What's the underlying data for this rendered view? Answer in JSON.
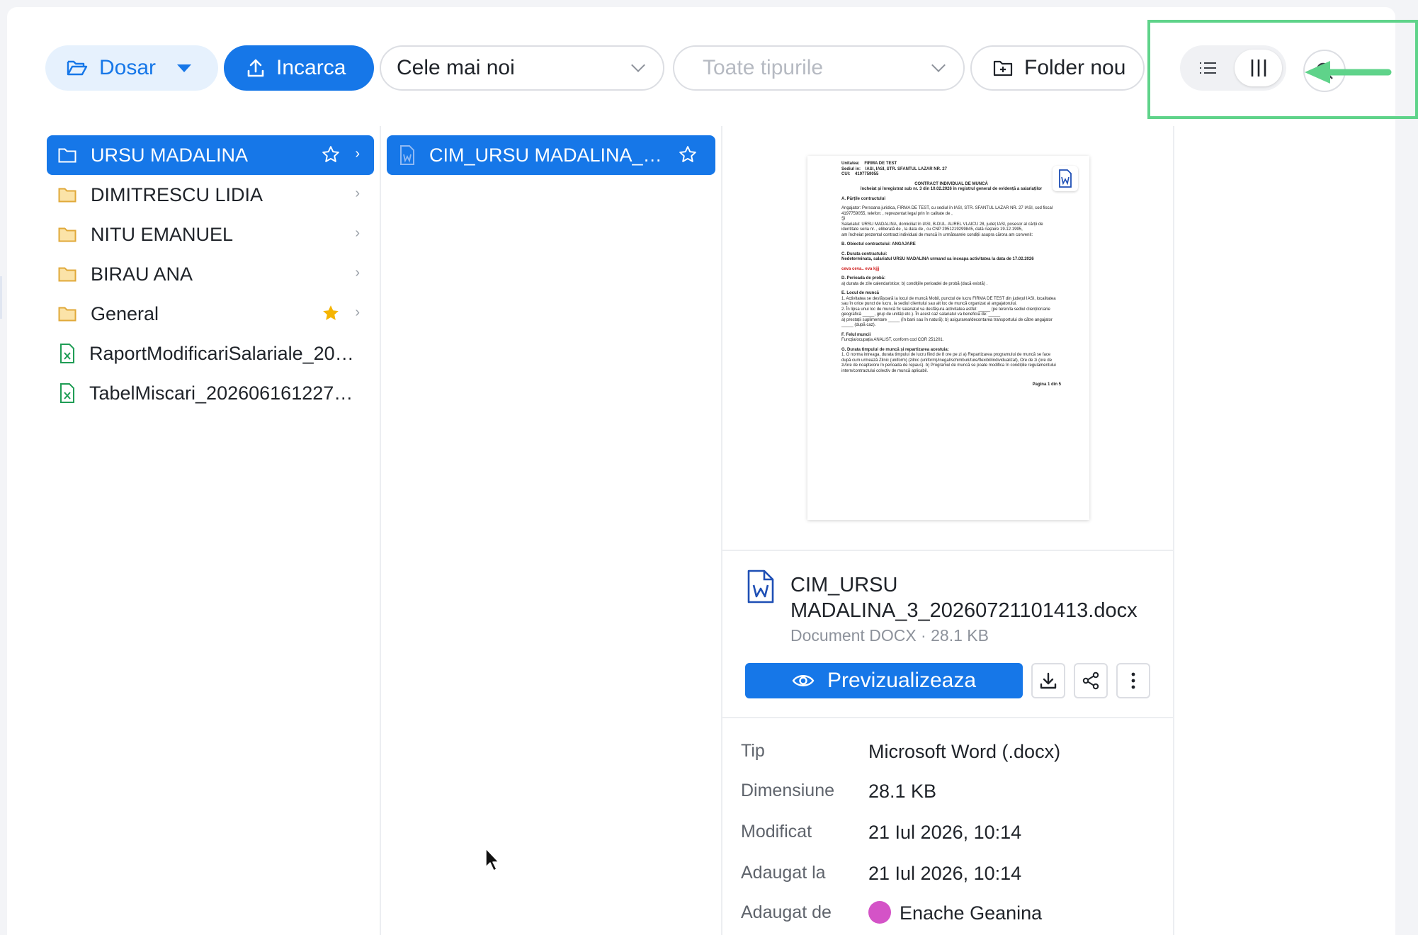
{
  "toolbar": {
    "folder_label": "Dosar",
    "upload_label": "Incarca",
    "sort_value": "Cele mai noi",
    "type_placeholder": "Toate tipurile",
    "new_folder_label": "Folder nou"
  },
  "columns": {
    "col1": [
      {
        "name": "URSU MADALINA",
        "kind": "folder",
        "starred": false,
        "selected": true
      },
      {
        "name": "DIMITRESCU LIDIA",
        "kind": "folder",
        "starred": false,
        "selected": false
      },
      {
        "name": "NITU EMANUEL",
        "kind": "folder",
        "starred": false,
        "selected": false
      },
      {
        "name": "BIRAU ANA",
        "kind": "folder",
        "starred": false,
        "selected": false
      },
      {
        "name": "General",
        "kind": "folder",
        "starred": true,
        "selected": false
      },
      {
        "name": "RaportModificariSalariale_202...",
        "kind": "excel",
        "selected": false
      },
      {
        "name": "TabelMiscari_20260616122717...",
        "kind": "excel",
        "selected": false
      }
    ],
    "col2": [
      {
        "name": "CIM_URSU MADALINA_3_...",
        "kind": "word",
        "starred": false,
        "selected": true
      }
    ]
  },
  "preview": {
    "doc": {
      "unitatea_label": "Unitatea:",
      "unitatea": "FIRMA DE TEST",
      "sediul_label": "Sediul in:",
      "sediul": "IASI, IASI, STR. SFANTUL LAZAR NR. 27",
      "cui_label": "CUI:",
      "cui": "4197759055",
      "title": "CONTRACT INDIVIDUAL DE MUNCĂ",
      "subtitle": "încheiat și înregistrat sub nr. 3 din 10.02.2026 în registrul general de evidență a salariaților",
      "a_head": "A. Părțile contractului",
      "a_text1": "Angajator: Persoana juridica, FIRMA DE TEST, cu sediul în IASI, STR. SFANTUL LAZAR NR. 27 IASI, cod fiscal 4197759055, telefon: , reprezentat legal prin în calitate de ,",
      "a_si": "Şi",
      "a_text2": "Salariatul: URSU MADALINA, domiciliat în IASI, B-DUL. AUREL VLAICU 28, județ IASI, posesor al cărții de identitate seria nr. , eliberată de , la data de , cu CNP 2951219299845, dată naștere 19.12.1995,",
      "a_text3": "am încheiat prezentul contract individual de muncă în următoarele condiții asupra cărora am convenit:",
      "b_head": "B. Obiectul contractului: ANGAJARE",
      "c_head": "C. Durata contractului:",
      "c_text": "Nedeterminata, salariatul URSU MADALINA urmand sa inceapa activitatea la data de 17.02.2026",
      "red_text": "ceva ceva.. eva kjjj",
      "d_head": "D. Perioada de probă:",
      "d_text": "a) durata de zile calendaristice; b) condițiile perioadei de probă (dacă există) .",
      "e_head": "E. Locul de muncă",
      "e_text1": "1. Activitatea se desfășoară la locul de muncă Mobil, punctul de lucru FIRMA DE TEST din județul IASI, localitatea sau în orice punct de lucru, la sediul clientului sau alt loc de muncă organizat al angajatorului.",
      "e_text2": "2. În lipsa unui loc de muncă fix salariatul va desfășura activitatea astfel: _____ (pe teren/la sediul clienților/arie geografică _____, grup de unități etc.). În acest caz salariatul va beneficia de: _____",
      "e_text3": "a) prestații suplimentare _____ (în bani sau în natură); b) asigurarea/decontarea transportului de către angajator _____ (după caz).",
      "f_head": "F. Felul muncii",
      "f_text": "Funcția/ocupația ANALIST, conform cod COR 251201.",
      "g_head": "G. Durata timpului de muncă și repartizarea acestuia:",
      "g_text": "1. O norma intreaga, durata timpului de lucru fiind de 8 ore pe zi a) Repartizarea programului de muncă se face după cum urmează Zilnic (uniform) (zilnic (uniform)/inegal/schimburi/ture/flexibil/individualizat), Ore de zi (ore de zi/ore de noapte/ore în perioada de repaus). b) Programul de muncă se poate modifica în condițiile regulamentului intern/contractului colectiv de muncă aplicabil.",
      "footer": "Pagina 1 din 5"
    },
    "file_name": "CIM_URSU MADALINA_3_20260721101413.docx",
    "file_sub": "Document DOCX · 28.1 KB",
    "preview_label": "Previzualizeaza"
  },
  "meta": [
    {
      "key": "Tip",
      "value": "Microsoft Word (.docx)"
    },
    {
      "key": "Dimensiune",
      "value": "28.1 KB"
    },
    {
      "key": "Modificat",
      "value": "21 Iul 2026, 10:14"
    },
    {
      "key": "Adaugat la",
      "value": "21 Iul 2026, 10:14"
    },
    {
      "key": "Adaugat de",
      "value": "Enache Geanina"
    }
  ],
  "colors": {
    "accent": "#1677e8",
    "highlight": "#5fd38a",
    "folder": "#f2c96b",
    "excel": "#1f9d55",
    "star": "#f5b400"
  }
}
